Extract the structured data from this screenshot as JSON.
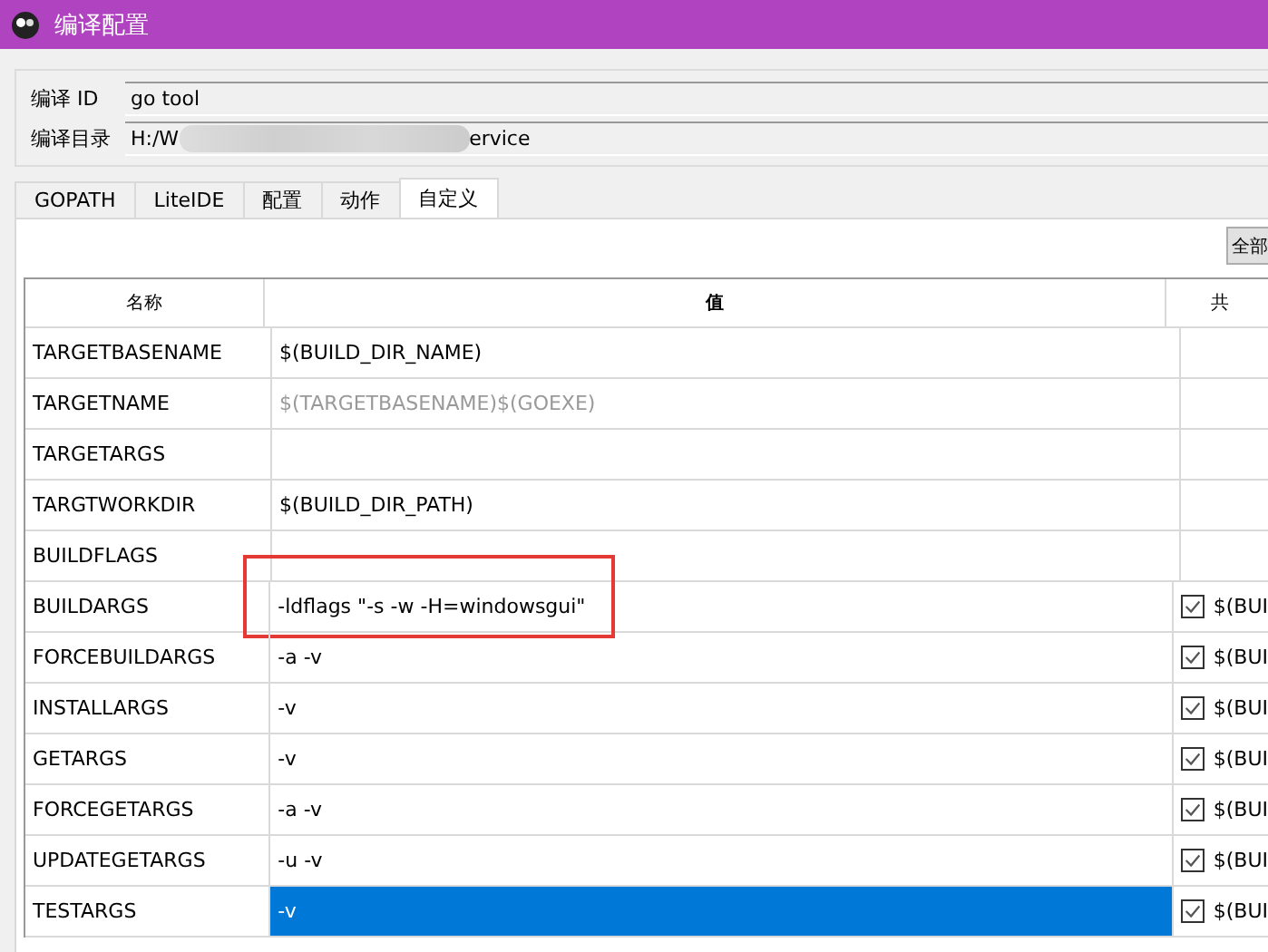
{
  "window": {
    "title": "编译配置"
  },
  "build": {
    "id_label": "编译 ID",
    "id_value": "go tool",
    "dir_label": "编译目录",
    "dir_prefix": "H:/W",
    "dir_suffix": "ervice"
  },
  "tabs": [
    {
      "label": "GOPATH",
      "selected": false
    },
    {
      "label": "LiteIDE",
      "selected": false
    },
    {
      "label": "配置",
      "selected": false
    },
    {
      "label": "动作",
      "selected": false
    },
    {
      "label": "自定义",
      "selected": true
    }
  ],
  "all_button": "全部",
  "table": {
    "columns": [
      "名称",
      "值",
      "共"
    ],
    "rows": [
      {
        "name": "TARGETBASENAME",
        "value": "$(BUILD_DIR_NAME)",
        "dimmed": false,
        "selected": false,
        "annotated": false
      },
      {
        "name": "TARGETNAME",
        "value": "$(TARGETBASENAME)$(GOEXE)",
        "dimmed": true,
        "selected": false,
        "annotated": false
      },
      {
        "name": "TARGETARGS",
        "selected": false,
        "annotated": false
      },
      {
        "name": "TARGTWORKDIR",
        "value": "$(BUILD_DIR_PATH)",
        "dimmed": false,
        "selected": false,
        "annotated": false
      },
      {
        "name": "BUILDFLAGS",
        "selected": false,
        "annotated": false
      },
      {
        "name": "BUILDARGS",
        "value": "-ldflags \"-s -w -H=windowsgui\"",
        "dimmed": false,
        "selected": false,
        "annotated": true,
        "shared": {
          "checked": true,
          "text": "$(BUI"
        }
      },
      {
        "name": "FORCEBUILDARGS",
        "value": "-a -v",
        "dimmed": false,
        "selected": false,
        "annotated": false,
        "shared": {
          "checked": true,
          "text": "$(BUI"
        }
      },
      {
        "name": "INSTALLARGS",
        "value": "-v",
        "dimmed": false,
        "selected": false,
        "annotated": false,
        "shared": {
          "checked": true,
          "text": "$(BUI"
        }
      },
      {
        "name": "GETARGS",
        "value": "-v",
        "dimmed": false,
        "selected": false,
        "annotated": false,
        "shared": {
          "checked": true,
          "text": "$(BUI"
        }
      },
      {
        "name": "FORCEGETARGS",
        "value": "-a -v",
        "dimmed": false,
        "selected": false,
        "annotated": false,
        "shared": {
          "checked": true,
          "text": "$(BUI"
        }
      },
      {
        "name": "UPDATEGETARGS",
        "value": "-u -v",
        "dimmed": false,
        "selected": false,
        "annotated": false,
        "shared": {
          "checked": true,
          "text": "$(BUI"
        }
      },
      {
        "name": "TESTARGS",
        "value": "-v",
        "dimmed": false,
        "selected": true,
        "annotated": false,
        "shared": {
          "checked": true,
          "text": "$(BUI"
        }
      }
    ]
  }
}
